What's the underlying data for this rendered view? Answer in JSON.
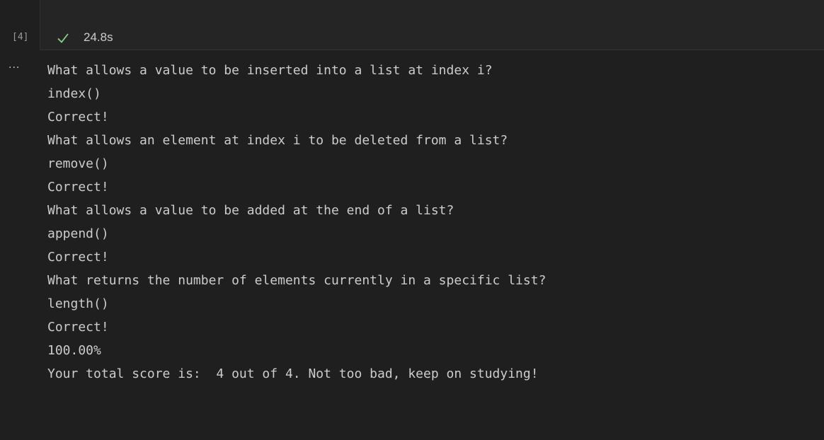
{
  "cell": {
    "execution_count": "[4]",
    "status_icon": "check-icon",
    "duration": "24.8s",
    "more_icon": "ellipsis-icon",
    "more_label": "···"
  },
  "colors": {
    "background": "#1f1f1f",
    "cell_header": "#252525",
    "text": "#cccccc",
    "success": "#89d185"
  },
  "output": {
    "lines": [
      "What allows a value to be inserted into a list at index i?",
      "index()",
      "Correct!",
      "What allows an element at index i to be deleted from a list?",
      "remove()",
      "Correct!",
      "What allows a value to be added at the end of a list?",
      "append()",
      "Correct!",
      "What returns the number of elements currently in a specific list?",
      "length()",
      "Correct!",
      "100.00%",
      "Your total score is:  4 out of 4. Not too bad, keep on studying!"
    ]
  }
}
